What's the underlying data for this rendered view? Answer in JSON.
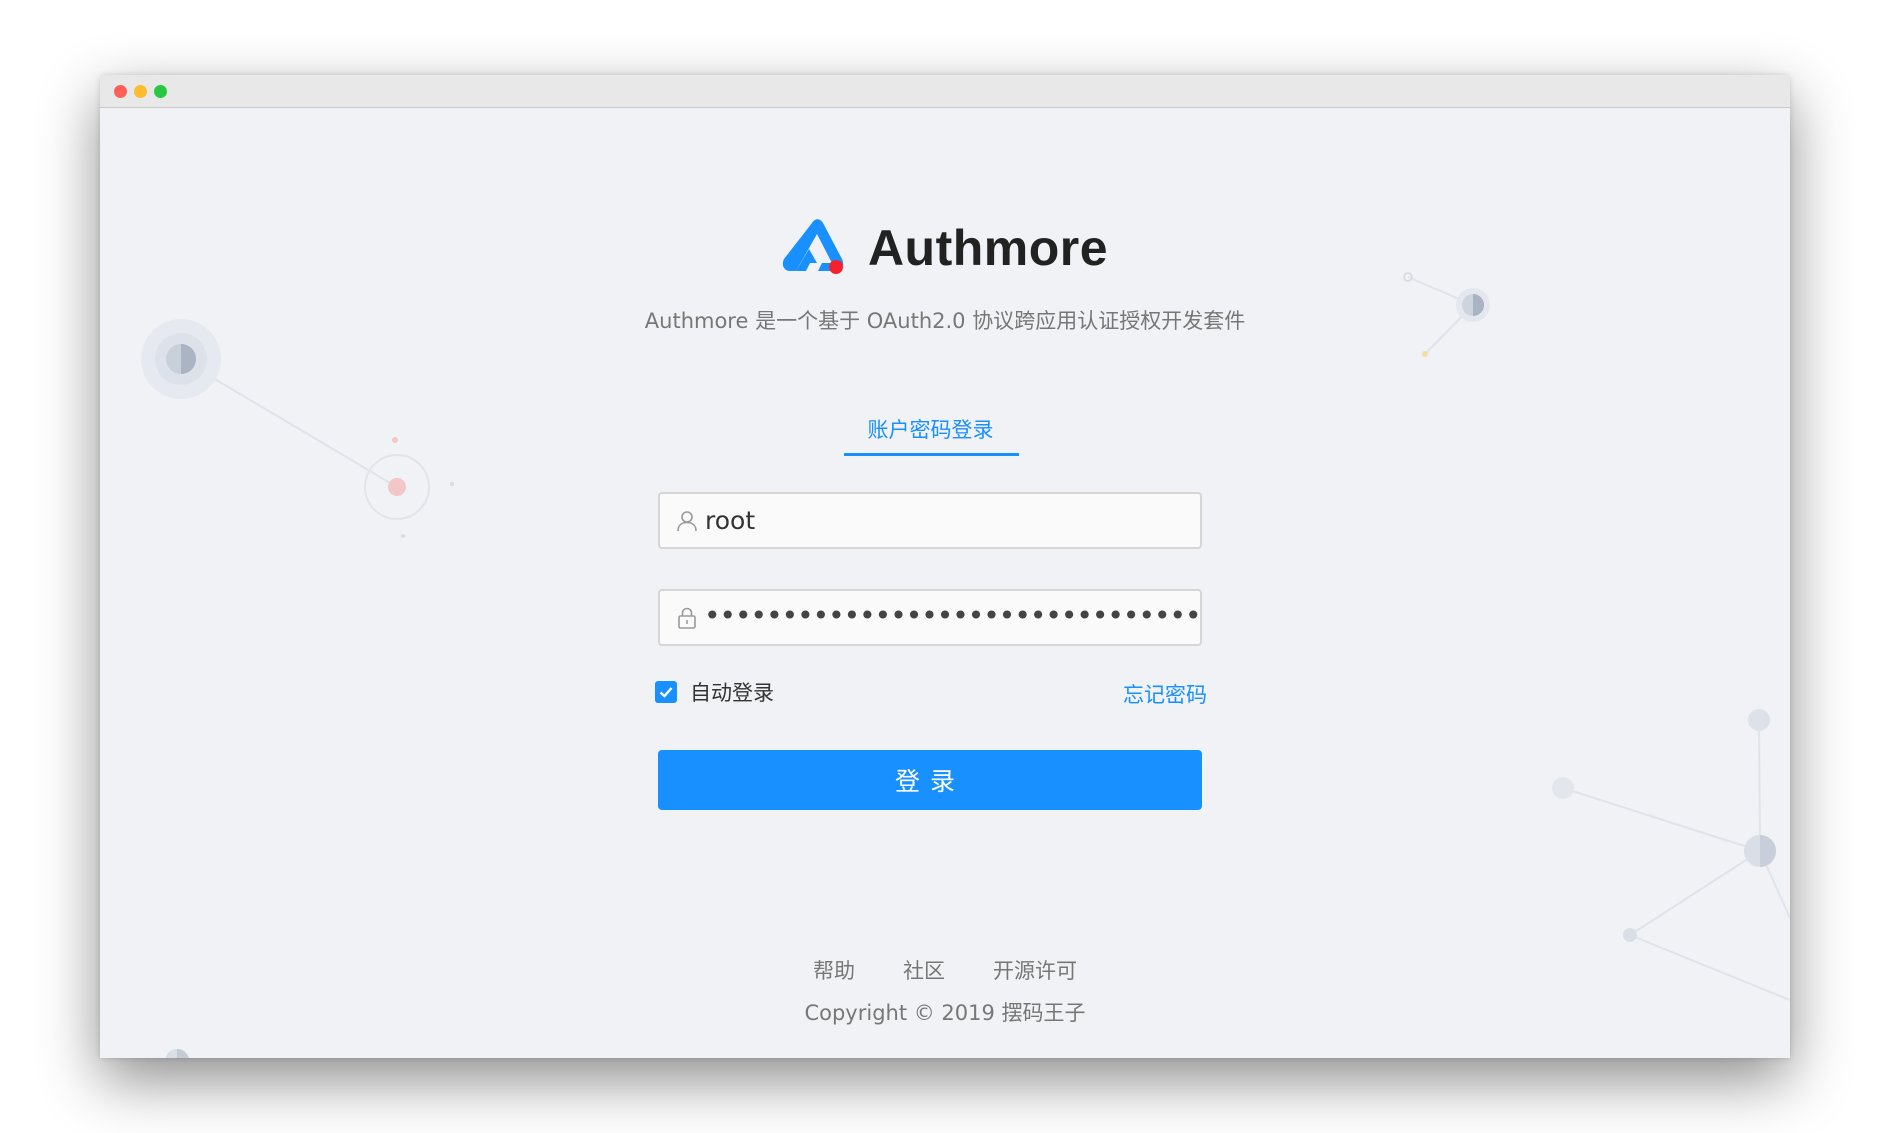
{
  "window": {
    "controls": [
      "close",
      "minimize",
      "zoom"
    ]
  },
  "brand": {
    "name": "Authmore",
    "subtitle": "Authmore 是一个基于 OAuth2.0 协议跨应用认证授权开发套件",
    "logo_colors": {
      "primary": "#1890ff",
      "dot": "#f5222d"
    }
  },
  "login": {
    "tab_label": "账户密码登录",
    "username_value": "root",
    "username_icon": "user-icon",
    "password_masked": "••••••••••••••••••••••••••••••••",
    "password_icon": "lock-icon",
    "remember_label": "自动登录",
    "remember_checked": true,
    "forgot_label": "忘记密码",
    "submit_label": "登录"
  },
  "footer": {
    "links": [
      "帮助",
      "社区",
      "开源许可"
    ],
    "copyright": "Copyright © 2019 摆码王子"
  },
  "colors": {
    "accent": "#1890ff",
    "background": "#f0f2f5"
  }
}
